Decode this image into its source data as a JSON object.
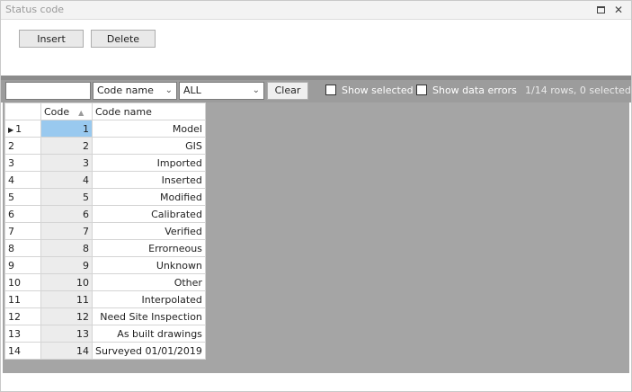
{
  "window": {
    "title": "Status code",
    "restore_icon": "restore-icon",
    "close_glyph": "✕"
  },
  "toolbar": {
    "insert_label": "Insert",
    "delete_label": "Delete"
  },
  "filter": {
    "search_value": "",
    "field_select": "Code name",
    "value_select": "ALL",
    "clear_label": "Clear",
    "show_selected_label": "Show selected",
    "show_errors_label": "Show data errors",
    "row_info": "1/14 rows, 0 selected"
  },
  "grid": {
    "columns": [
      "Code",
      "Code name"
    ],
    "current_row_marker": "▶",
    "rows": [
      {
        "n": "1",
        "code": "1",
        "name": "Model"
      },
      {
        "n": "2",
        "code": "2",
        "name": "GIS"
      },
      {
        "n": "3",
        "code": "3",
        "name": "Imported"
      },
      {
        "n": "4",
        "code": "4",
        "name": "Inserted"
      },
      {
        "n": "5",
        "code": "5",
        "name": "Modified"
      },
      {
        "n": "6",
        "code": "6",
        "name": "Calibrated"
      },
      {
        "n": "7",
        "code": "7",
        "name": "Verified"
      },
      {
        "n": "8",
        "code": "8",
        "name": "Errorneous"
      },
      {
        "n": "9",
        "code": "9",
        "name": "Unknown"
      },
      {
        "n": "10",
        "code": "10",
        "name": "Other"
      },
      {
        "n": "11",
        "code": "11",
        "name": "Interpolated"
      },
      {
        "n": "12",
        "code": "12",
        "name": "Need Site Inspection"
      },
      {
        "n": "13",
        "code": "13",
        "name": "As built drawings"
      },
      {
        "n": "14",
        "code": "14",
        "name": "Surveyed 01/01/2019"
      }
    ]
  },
  "colors": {
    "selected_cell": "#99c9ef",
    "grid_background": "#a5a5a5",
    "filter_bar": "#9c9c9c"
  }
}
